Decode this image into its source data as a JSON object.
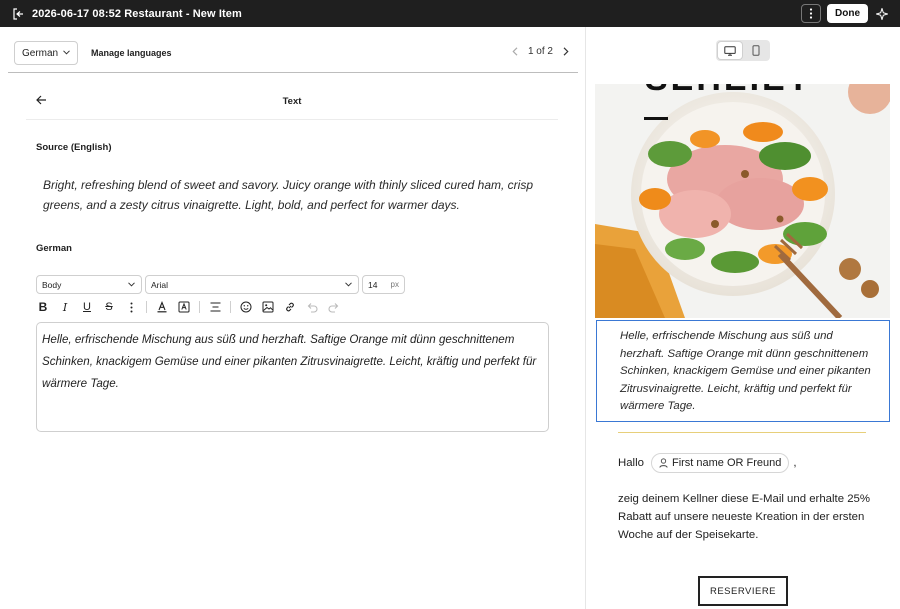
{
  "window": {
    "title": "2026-06-17 08:52 Restaurant - New Item",
    "done_label": "Done"
  },
  "langbar": {
    "language": "German",
    "manage_label": "Manage languages",
    "pager": "1 of 2"
  },
  "panel": {
    "title": "Text"
  },
  "source": {
    "label": "Source (English)",
    "text": "Bright, refreshing blend of sweet and savory. Juicy orange with thinly sliced cured ham, crisp greens, and a zesty citrus vinaigrette. Light, bold, and perfect for warmer days."
  },
  "target": {
    "label": "German",
    "style": "Body",
    "font": "Arial",
    "size": "14",
    "size_unit": "px",
    "text": "Helle, erfrischende Mischung aus süß und herzhaft. Saftige Orange mit dünn geschnittenem Schinken, knackigem Gemüse und einer pikanten Zitrusvinaigrette. Leicht, kräftig und perfekt für wärmere Tage."
  },
  "toolbar": {
    "icons": [
      "bold-icon",
      "italic-icon",
      "underline-icon",
      "strikethrough-icon",
      "more-icon",
      "text-color-icon",
      "highlight-icon",
      "align-icon",
      "emoji-icon",
      "image-icon",
      "link-icon",
      "undo-icon",
      "redo-icon"
    ]
  },
  "preview": {
    "hero_title": "SEHEIET",
    "selected_text": "Helle, erfrischende Mischung aus süß und herzhaft. Saftige Orange mit dünn geschnittenem Schinken, knackigem Gemüse und einer pikanten Zitrusvinaigrette. Leicht, kräftig und perfekt für wärmere Tage.",
    "greeting": "Hallo",
    "merge_tag": "First name OR Freund",
    "comma": ",",
    "body": "zeig deinem Kellner diese E-Mail und erhalte 25% Rabatt auf unsere neueste Kreation in der ersten Woche auf der Speisekarte.",
    "button": "RESERVIERE"
  },
  "colors": {
    "topbar": "#1f1f1f",
    "selection": "#3a78d4",
    "gold_divider": "#e7cf7a"
  }
}
